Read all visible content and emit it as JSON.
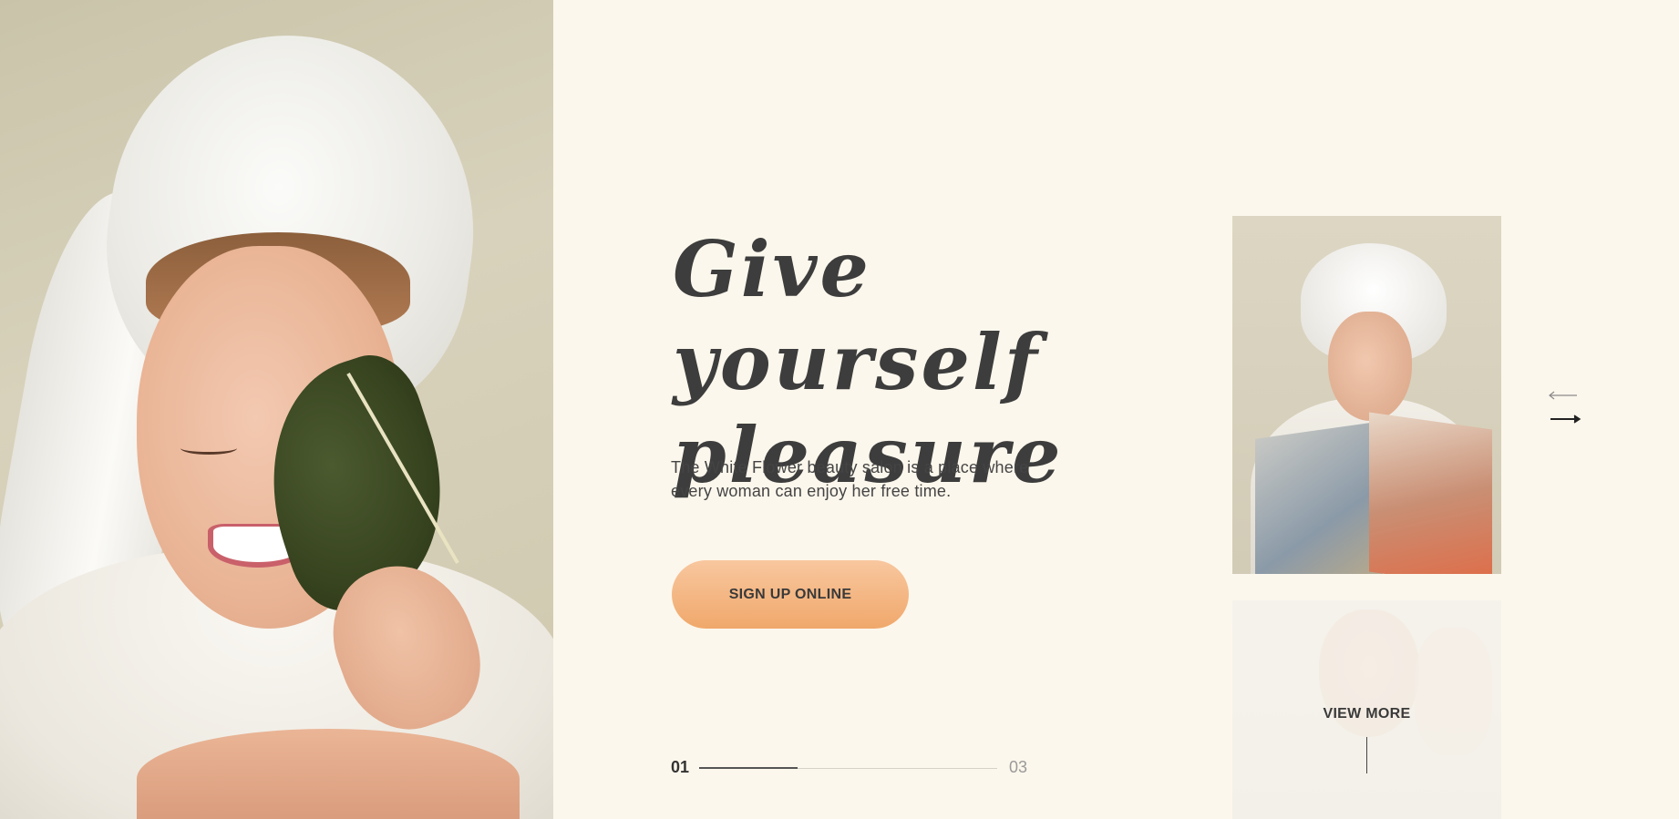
{
  "hero": {
    "title_line1": "Give yourself",
    "title_line2": "pleasure",
    "description": "The White Flower beauty salon is a place where every woman can enjoy her free time.",
    "cta_label": "SIGN UP ONLINE"
  },
  "slider": {
    "current": "01",
    "total": "03",
    "progress_fraction": 0.33,
    "view_more_label": "VIEW MORE"
  },
  "icons": {
    "prev": "arrow-left-icon",
    "next": "arrow-right-icon"
  },
  "colors": {
    "background": "#fcf7ec",
    "cta_gradient_top": "#f8c79f",
    "cta_gradient_bottom": "#f0a86b",
    "text": "#3d3d3d"
  }
}
